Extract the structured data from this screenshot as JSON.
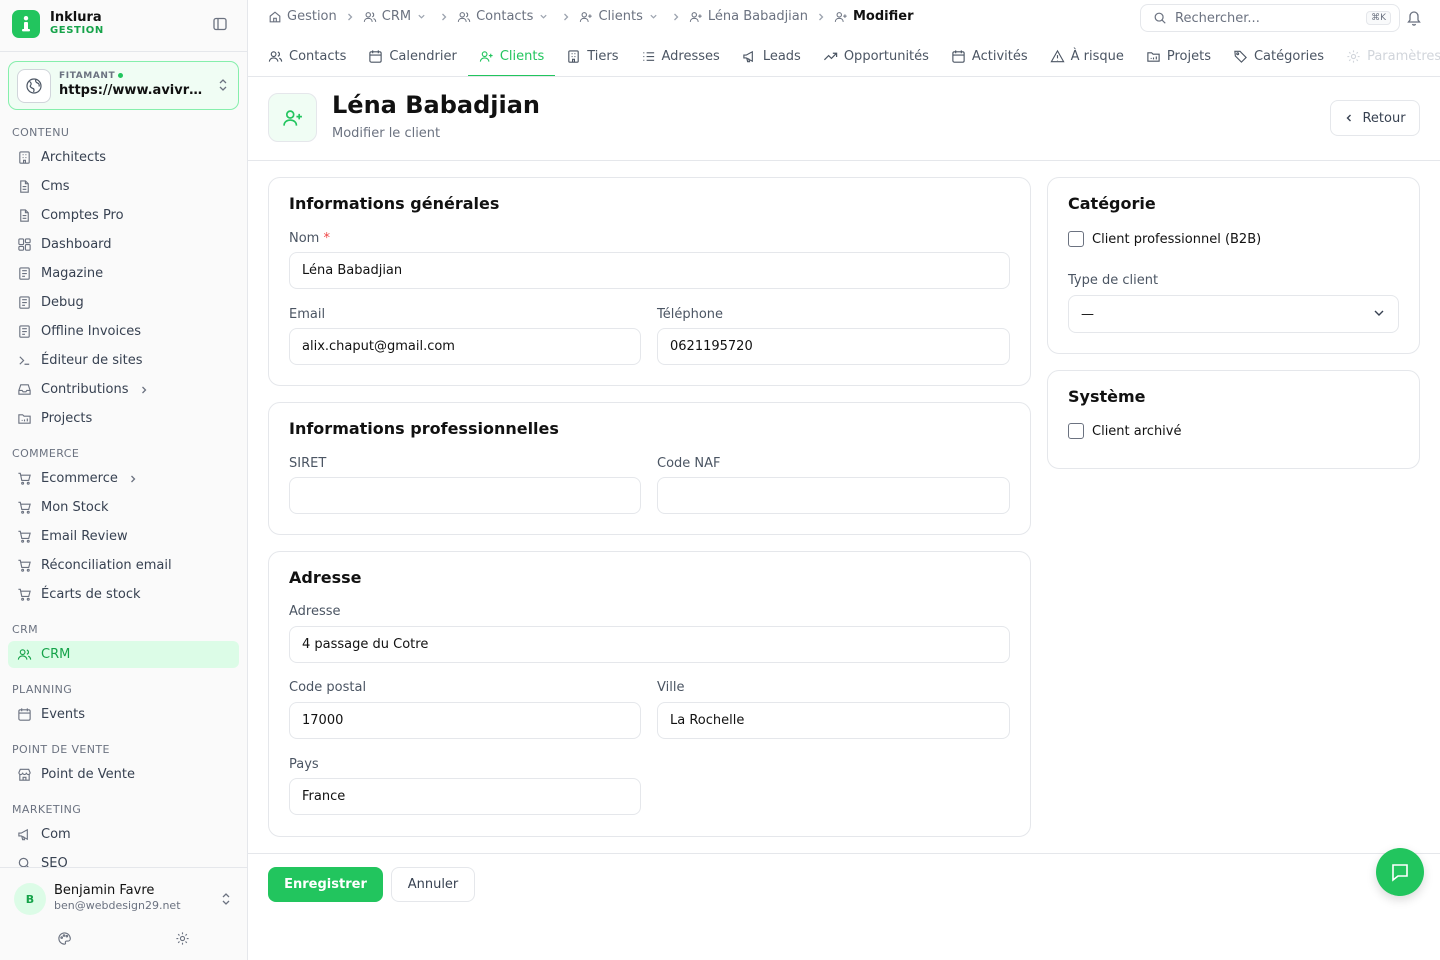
{
  "brand": {
    "name": "Inklura",
    "sub": "GESTION"
  },
  "site": {
    "label": "FITAMANT",
    "url": "https://www.avivre-immobilier.fr"
  },
  "sidebar": {
    "sections": {
      "contenu": "CONTENU",
      "commerce": "COMMERCE",
      "crm": "CRM",
      "planning": "PLANNING",
      "pdv": "POINT DE VENTE",
      "marketing": "MARKETING"
    },
    "contenu": [
      "Architects",
      "Cms",
      "Comptes Pro",
      "Dashboard",
      "Magazine",
      "Debug",
      "Offline Invoices",
      "Éditeur de sites",
      "Contributions",
      "Projects"
    ],
    "commerce": [
      "Ecommerce",
      "Mon Stock",
      "Email Review",
      "Réconciliation email",
      "Écarts de stock"
    ],
    "crm": [
      "CRM"
    ],
    "planning": [
      "Events"
    ],
    "pdv": [
      "Point de Vente"
    ],
    "marketing": [
      "Com",
      "SEO"
    ]
  },
  "user": {
    "initial": "B",
    "name": "Benjamin Favre",
    "email": "ben@webdesign29.net"
  },
  "breadcrumb": [
    "Gestion",
    "CRM",
    "Contacts",
    "Clients",
    "Léna Babadjian",
    "Modifier"
  ],
  "search": {
    "placeholder": "Rechercher...",
    "shortcut": "⌘K"
  },
  "tabs": [
    "Contacts",
    "Calendrier",
    "Clients",
    "Tiers",
    "Adresses",
    "Leads",
    "Opportunités",
    "Activités",
    "À risque",
    "Projets",
    "Catégories",
    "Paramètres"
  ],
  "active_tab": "Clients",
  "header": {
    "title": "Léna Babadjian",
    "subtitle": "Modifier le client",
    "back_label": "Retour"
  },
  "general": {
    "title": "Informations générales",
    "name_label": "Nom",
    "required_mark": "*",
    "name_value": "Léna Babadjian",
    "email_label": "Email",
    "email_value": "alix.chaput@gmail.com",
    "phone_label": "Téléphone",
    "phone_value": "0621195720"
  },
  "pro": {
    "title": "Informations professionnelles",
    "siret_label": "SIRET",
    "siret_value": "",
    "naf_label": "Code NAF",
    "naf_value": ""
  },
  "address": {
    "title": "Adresse",
    "address_label": "Adresse",
    "address_value": "4 passage du Cotre",
    "zip_label": "Code postal",
    "zip_value": "17000",
    "city_label": "Ville",
    "city_value": "La Rochelle",
    "country_label": "Pays",
    "country_value": "France"
  },
  "category": {
    "title": "Catégorie",
    "b2b_label": "Client professionnel (B2B)",
    "b2b_checked": false,
    "type_label": "Type de client",
    "type_value": "—"
  },
  "system": {
    "title": "Système",
    "archived_label": "Client archivé",
    "archived_checked": false
  },
  "footer": {
    "save_label": "Enregistrer",
    "cancel_label": "Annuler"
  },
  "colors": {
    "accent": "#22c55e",
    "accent_light": "#dcfce7",
    "required": "#ef4444"
  }
}
